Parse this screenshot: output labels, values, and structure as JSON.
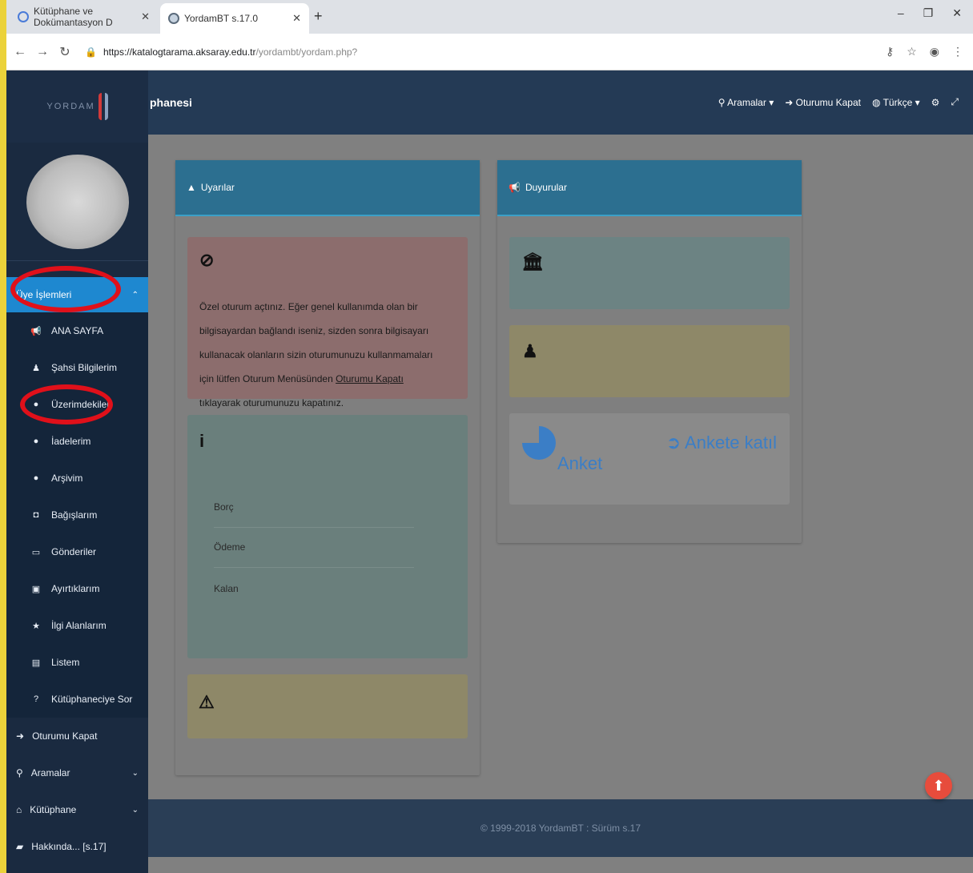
{
  "browser": {
    "tabs": [
      {
        "title": "Kütüphane ve Dokümantasyon D",
        "active": false
      },
      {
        "title": "YordamBT s.17.0",
        "active": true
      }
    ],
    "new_tab": "+",
    "url_host": "https://katalogtarama.aksaray.edu.tr",
    "url_path": "/yordambt/yordam.php?"
  },
  "sidebar": {
    "logo": "YORDAM",
    "member_menu": {
      "label": "Üye İşlemleri",
      "items": [
        {
          "label": "ANA SAYFA",
          "icon": "megaphone-icon",
          "glyph": "📢"
        },
        {
          "label": "Şahsi Bilgilerim",
          "icon": "user-icon",
          "glyph": "♟"
        },
        {
          "label": "Üzerimdekiler",
          "icon": "circle-arrow-icon",
          "glyph": "●"
        },
        {
          "label": "İadelerim",
          "icon": "circle-arrow-icon",
          "glyph": "●"
        },
        {
          "label": "Arşivim",
          "icon": "circle-arrow-icon",
          "glyph": "●"
        },
        {
          "label": "Bağışlarım",
          "icon": "gift-icon",
          "glyph": "◘"
        },
        {
          "label": "Gönderiler",
          "icon": "inbox-icon",
          "glyph": "▭"
        },
        {
          "label": "Ayırtıklarım",
          "icon": "calendar-icon",
          "glyph": "▣"
        },
        {
          "label": "İlgi Alanlarım",
          "icon": "star-icon",
          "glyph": "★"
        },
        {
          "label": "Listem",
          "icon": "list-icon",
          "glyph": "▤"
        },
        {
          "label": "Kütüphaneciye Sor",
          "icon": "question-icon",
          "glyph": "?"
        }
      ]
    },
    "bottom_items": [
      {
        "label": "Oturumu Kapat",
        "icon": "logout-icon",
        "glyph": "➜",
        "caret": ""
      },
      {
        "label": "Aramalar",
        "icon": "search-icon",
        "glyph": "⚲",
        "caret": "⌄"
      },
      {
        "label": "Kütüphane",
        "icon": "library-icon",
        "glyph": "⌂",
        "caret": "⌄"
      },
      {
        "label": "Hakkında... [s.17]",
        "icon": "book-icon",
        "glyph": "▰",
        "caret": ""
      }
    ]
  },
  "topbar": {
    "title": "phanesi",
    "search_label": "Aramalar",
    "logout_label": "Oturumu Kapat",
    "language_label": "Türkçe"
  },
  "warnings_panel": {
    "title": "Uyarılar",
    "alert_text_before": "Özel oturum açtınız. Eğer genel kullanımda olan bir bilgisayardan bağlandı iseniz, sizden sonra bilgisayarı kullanacak olanların sizin oturumunuzu kullanmamaları için lütfen Oturum Menüsünden ",
    "alert_link": "Oturumu Kapatı",
    "alert_text_after": " tıklayarak oturumunuzu kapatınız.",
    "finance": {
      "debt": "Borç",
      "payment": "Ödeme",
      "remaining": "Kalan"
    }
  },
  "announcements_panel": {
    "title": "Duyurular",
    "survey_label": "Anket",
    "survey_link": "Ankete katıl"
  },
  "footer": {
    "text": "© 1999-2018 YordamBT : Sürüm s.17"
  },
  "colors": {
    "accent": "#1e88d0",
    "sidebar": "#1a2a40",
    "annotation": "#e0101a",
    "scroll_button": "#e74c3c"
  }
}
